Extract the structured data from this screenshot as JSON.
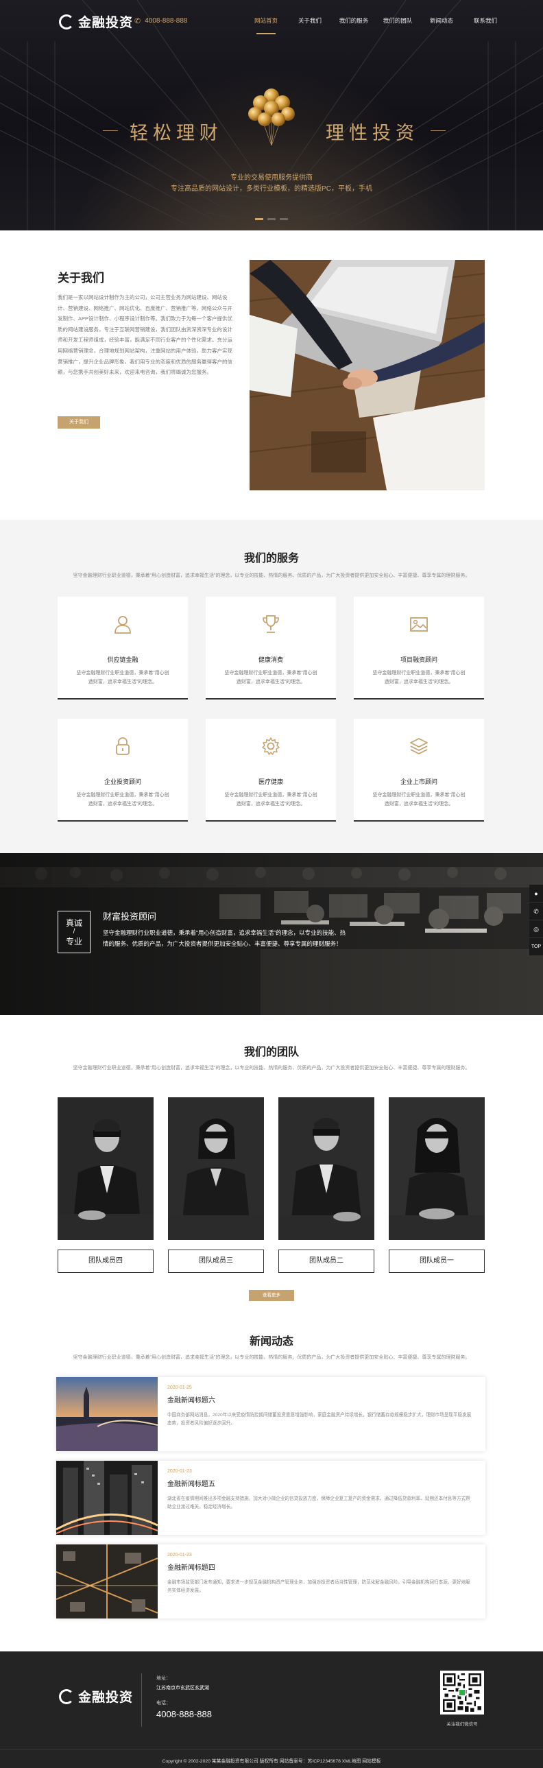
{
  "brand": {
    "name": "金融投资",
    "phone": "4008-888-888"
  },
  "nav": [
    {
      "label": "网站首页",
      "active": true
    },
    {
      "label": "关于我们",
      "active": false
    },
    {
      "label": "我们的服务",
      "active": false
    },
    {
      "label": "我们的团队",
      "active": false
    },
    {
      "label": "新闻动态",
      "active": false
    },
    {
      "label": "联系我们",
      "active": false
    }
  ],
  "hero": {
    "left_text": "轻松理财",
    "right_text": "理性投资",
    "sub1": "专业的交易使用服务提供商",
    "sub2": "专注高品质的网站设计，多类行业模板，的精选版PC，平板，手机",
    "slides": 3,
    "active_slide": 0
  },
  "about": {
    "title": "关于我们",
    "text": "我们是一家以网站设计制作为主的公司，公司主营业务为网站建设、网站设计、营销建设、网络推广、网站优化、百度推广、营销推广等、网络公众号开发制作、APP设计制作、小程序设计制作等。我们致力于为每一个客户提供优质的网站建设服务，专注于互联网营销建设，我们团队由资深资深专业的设计师和开发工程师组成，经验丰富，能满足不同行业客户的个性化需求。充分运用网络营销理念，合理地规划网站架构，注重网站的用户体验，助力客户实现营销推广，提升企业品牌形象，我们用专业的态度和优质的服务赢得客户的信赖，与您携手共创美好未来，欢迎来电咨询，我们将竭诚为您服务。",
    "button": "关于我们"
  },
  "services": {
    "title": "我们的服务",
    "desc": "坚守金融理财行业职业道德，秉承着“用心创造财富，追求幸福生活”的理念，以专业的技能、热情的服务、优质的产品，为广大投资者提供更加安全贴心、丰富便捷、尊享专属的理财服务。",
    "items": [
      {
        "name": "供应链金融",
        "icon": "user-icon",
        "desc": "坚守金融理财行业职业道德，秉承着“用心创造财富，追求幸福生活”的理念。"
      },
      {
        "name": "健康消费",
        "icon": "trophy-icon",
        "desc": "坚守金融理财行业职业道德，秉承着“用心创造财富，追求幸福生活”的理念。"
      },
      {
        "name": "项目融资顾问",
        "icon": "image-icon",
        "desc": "坚守金融理财行业职业道德，秉承着“用心创造财富，追求幸福生活”的理念。"
      },
      {
        "name": "企业投资顾问",
        "icon": "lock-icon",
        "desc": "坚守金融理财行业职业道德，秉承着“用心创造财富，追求幸福生活”的理念。"
      },
      {
        "name": "医疗健康",
        "icon": "gear-icon",
        "desc": "坚守金融理财行业职业道德，秉承着“用心创造财富，追求幸福生活”的理念。"
      },
      {
        "name": "企业上市顾问",
        "icon": "layers-icon",
        "desc": "坚守金融理财行业职业道德，秉承着“用心创造财富，追求幸福生活”的理念。"
      }
    ]
  },
  "banner": {
    "badge_top": "真诚",
    "badge_bottom": "专业",
    "title": "财富投资顾问",
    "text": "坚守金融理财行业职业道德，秉承着“用心创造财富，追求幸福生活”的理念，以专业的技能、热情的服务、优质的产品，为广大投资者提供更加安全贴心、丰富便捷、尊享专属的理财服务！"
  },
  "side_tools": [
    "chat-icon",
    "phone-icon",
    "wechat-icon",
    "top-icon"
  ],
  "side_top_label": "TOP",
  "team": {
    "title": "我们的团队",
    "desc": "坚守金融理财行业职业道德，秉承着“用心创造财富，追求幸福生活”的理念，以专业的技能、热情的服务、优质的产品，为广大投资者提供更加安全贴心、丰富便捷、尊享专属的理财服务。",
    "members": [
      "团队成员四",
      "团队成员三",
      "团队成员二",
      "团队成员一"
    ],
    "more": "查看更多"
  },
  "news": {
    "title": "新闻动态",
    "desc": "坚守金融理财行业职业道德，秉承着“用心创造财富，追求幸福生活”的理念，以专业的技能、热情的服务、优质的产品，为广大投资者提供更加安全贴心、丰富便捷、尊享专属的理财服务。",
    "items": [
      {
        "date": "2020-01-25",
        "title": "金融新闻标题六",
        "excerpt": "中国商务部网站消息，2020年以来受疫情防控期间储蓄投资意愿增强影响，家庭金融资产持续增长，银行储蓄存款规模稳步扩大，理财市场呈现平稳发展态势，投资者风险偏好逐步回升。"
      },
      {
        "date": "2020-01-23",
        "title": "金融新闻标题五",
        "excerpt": "湖北省在疫情期间推出多项金融支持措施，加大对小微企业的信贷投放力度，保障企业复工复产的资金需求，通过降低贷款利率、延期还本付息等方式帮助企业渡过难关，稳定经济增长。"
      },
      {
        "date": "2020-01-23",
        "title": "金融新闻标题四",
        "excerpt": "金融市场监管部门发布通知，要求进一步规范金融机构资产管理业务，加强对投资者适当性管理，防范化解金融风险，引导金融机构回归本源，更好地服务实体经济发展。"
      }
    ]
  },
  "footer": {
    "address_label": "地址：",
    "address": "江苏南京市玄武区玄武湖",
    "phone_label": "电话：",
    "phone": "4008-888-888",
    "qr_caption": "关注我们微信号",
    "copyright": "Copyright © 2002-2020 某某金融投资有限公司 版权所有 网站备案号：苏ICP12345678 XML地图 网站模板"
  },
  "colors": {
    "gold": "#c6a26e",
    "dark": "#242424"
  }
}
